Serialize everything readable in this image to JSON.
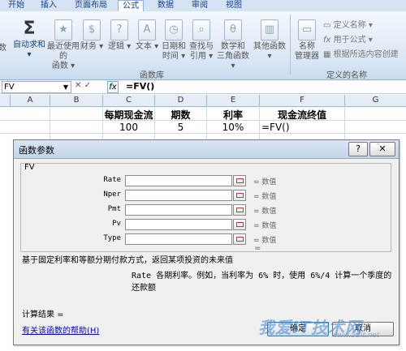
{
  "ribbon": {
    "tabs": [
      "开始",
      "插入",
      "页面布局",
      "公式",
      "数据",
      "审阅",
      "视图"
    ],
    "active_tab": "公式",
    "buttons": {
      "insert_fn_partial": "数",
      "autosum_1": "自动求和",
      "recent_1": "最近使用的",
      "recent_2": "函数",
      "finance": "财务",
      "logical": "逻辑",
      "text": "文本",
      "datetime_1": "日期和",
      "datetime_2": "时间",
      "lookup_1": "查找与",
      "lookup_2": "引用",
      "math_1": "数学和",
      "math_2": "三角函数",
      "other": "其他函数",
      "name_mgr_1": "名称",
      "name_mgr_2": "管理器",
      "define_name": "定义名称",
      "use_in_formula": "用于公式",
      "create_from_sel": "根据所选内容创建"
    },
    "group_labels": {
      "function_library": "函数库",
      "defined_names": "定义的名称"
    }
  },
  "formula_bar": {
    "name_box": "FV",
    "cancel": "✕",
    "enter": "✓",
    "fx": "fx",
    "formula": "=FV()"
  },
  "grid": {
    "columns": [
      "A",
      "B",
      "C",
      "D",
      "E",
      "F",
      "G"
    ],
    "row1": [
      "每期现金流",
      "期数",
      "利率",
      "现金流终值"
    ],
    "row2": [
      "100",
      "5",
      "10%",
      "=FV()"
    ]
  },
  "dialog": {
    "title": "函数参数",
    "help_btn": "?",
    "close_btn": "✕",
    "function_name": "FV",
    "args": [
      {
        "name": "Rate",
        "value_hint": "= 数值"
      },
      {
        "name": "Nper",
        "value_hint": "= 数值"
      },
      {
        "name": "Pmt",
        "value_hint": "= 数值"
      },
      {
        "name": "Pv",
        "value_hint": "= 数值"
      },
      {
        "name": "Type",
        "value_hint": "= 数值"
      }
    ],
    "result_eq": "=",
    "description": "基于固定利率和等额分期付款方式，返回某项投资的未来值",
    "arg_description": "Rate  各期利率。例如，当利率为 6% 时，使用 6%/4 计算一个季度的还款额",
    "calc_result": "计算结果 =",
    "help_link": "有关该函数的帮助(H)",
    "ok": "确定",
    "cancel": "取消"
  },
  "watermark": {
    "text": "我爱IT技术网",
    "sub": "www.52it.net"
  }
}
